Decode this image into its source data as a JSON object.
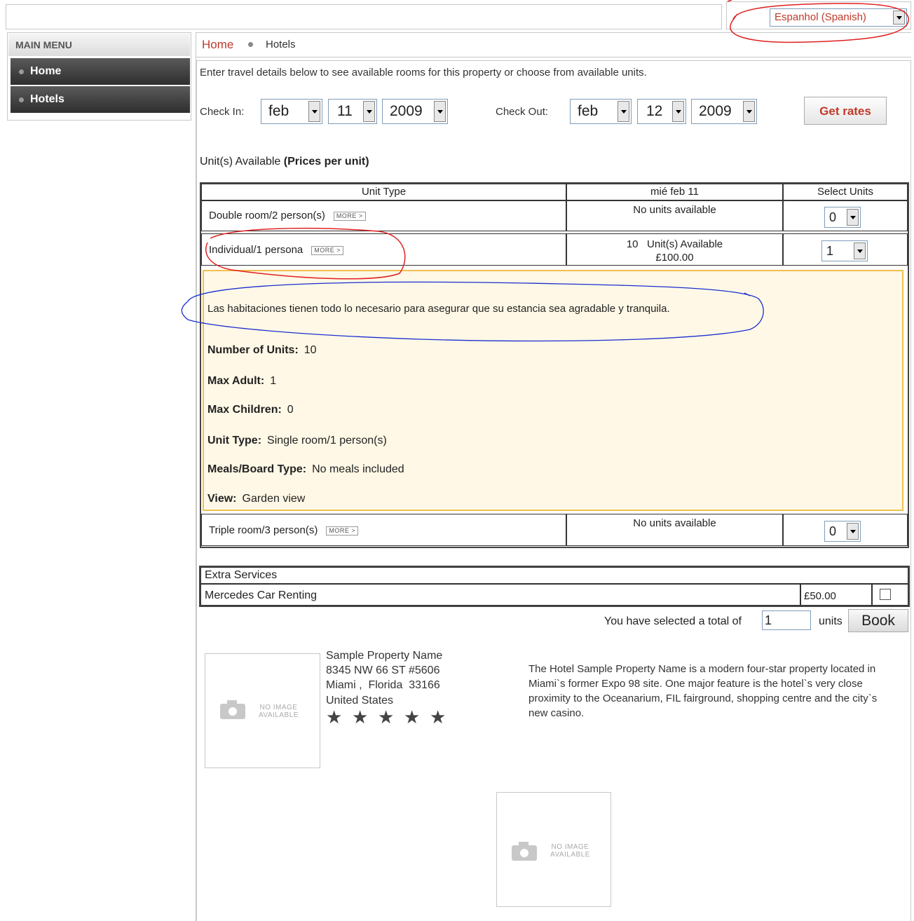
{
  "language": {
    "selected": "Espanhol (Spanish)"
  },
  "sidebar": {
    "title": "MAIN MENU",
    "items": [
      {
        "label": "Home"
      },
      {
        "label": "Hotels"
      }
    ]
  },
  "breadcrumb": {
    "home": "Home",
    "current": "Hotels"
  },
  "intro": "Enter travel details below to see available rooms for this property or choose from available units.",
  "search": {
    "checkin_label": "Check In:",
    "checkin": {
      "month": "feb",
      "day": "11",
      "year": "2009"
    },
    "checkout_label": "Check Out:",
    "checkout": {
      "month": "feb",
      "day": "12",
      "year": "2009"
    },
    "get_rates": "Get rates"
  },
  "units": {
    "heading": "Unit(s) Available",
    "heading_bold": "(Prices per unit)",
    "columns": [
      "Unit Type",
      "mié feb 11",
      "Select Units"
    ],
    "more_label": "MORE >",
    "rows": [
      {
        "type": "Double room/2 person(s)",
        "availability": "No units available",
        "price": "",
        "select": "0"
      },
      {
        "type": "Individual/1 persona",
        "availability": "10   Unit(s) Available",
        "price": "£100.00",
        "select": "1"
      },
      {
        "type": "Triple room/3 person(s)",
        "availability": "No units available",
        "price": "",
        "select": "0"
      }
    ],
    "detail": {
      "description": "Las habitaciones tienen todo lo necesario para asegurar que su estancia sea agradable y tranquila.",
      "fields": [
        {
          "label": "Number of Units:",
          "value": "10"
        },
        {
          "label": "Max Adult:",
          "value": "1"
        },
        {
          "label": "Max Children:",
          "value": "0"
        },
        {
          "label": "Unit Type:",
          "value": "Single room/1 person(s)"
        },
        {
          "label": "Meals/Board Type:",
          "value": "No meals included"
        },
        {
          "label": "View:",
          "value": "Garden view"
        }
      ]
    }
  },
  "extras": {
    "heading": "Extra Services",
    "items": [
      {
        "name": "Mercedes Car Renting",
        "price": "£50.00",
        "checked": false
      }
    ]
  },
  "booking": {
    "prefix": "You have selected a total of",
    "units_value": "1",
    "suffix": "units",
    "book": "Book"
  },
  "property": {
    "name": "Sample Property Name",
    "address1": "8345 NW 66 ST #5606",
    "city_line": "Miami ,  Florida  33166",
    "country": "United States",
    "stars": 5,
    "description": "The Hotel Sample Property Name is a modern four-star property located in Miami`s former Expo 98 site. One major feature is the hotel`s very close proximity to the Oceanarium, FIL fairground, shopping centre and the city`s new casino.",
    "no_image_line1": "NO IMAGE",
    "no_image_line2": "AVAILABLE"
  },
  "colors": {
    "accent": "#c0392b",
    "highlight_bg": "#fff8e6",
    "highlight_border": "#f0c050"
  }
}
